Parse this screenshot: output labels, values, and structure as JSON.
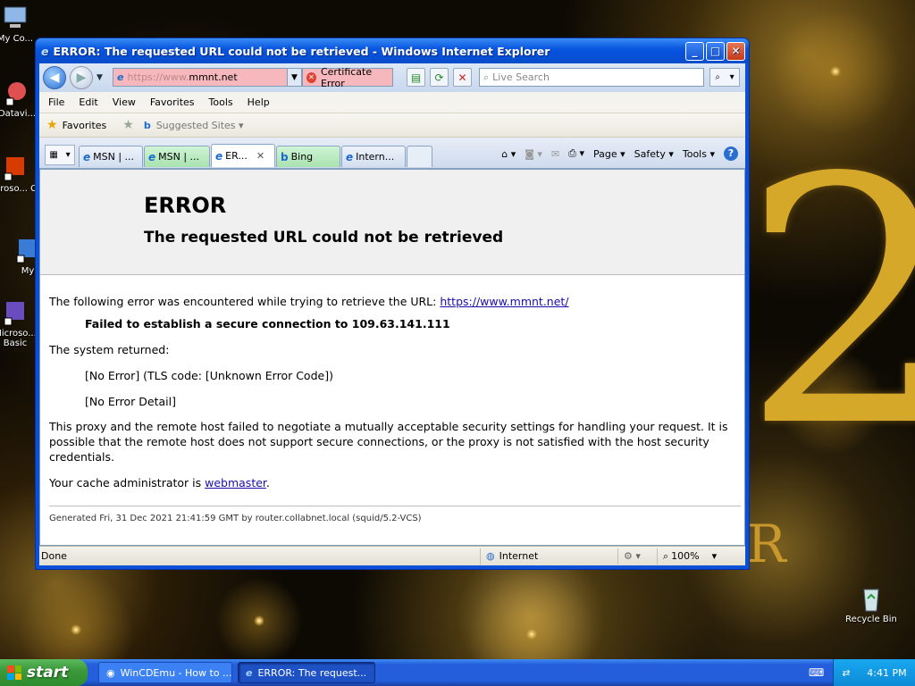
{
  "desktop": {
    "icons": [
      {
        "label": "My Co..."
      },
      {
        "label": "Datavi..."
      },
      {
        "label": "Microso... C..."
      },
      {
        "label": "My"
      },
      {
        "label": "Microso... Basic"
      },
      {
        "label": "Recycle Bin"
      }
    ],
    "wallpaper_numeral": "2",
    "wallpaper_letter": "R"
  },
  "window": {
    "title": "ERROR: The requested URL could not be retrieved - Windows Internet Explorer",
    "buttons": {
      "minimize": "_",
      "maximize": "□",
      "close": "✕"
    }
  },
  "navbar": {
    "back": "◀",
    "forward": "▶",
    "address_dim": "https://www.",
    "address_main": "mmnt.net",
    "cert_label": "Certificate Error",
    "search_placeholder": "Live Search"
  },
  "menubar": {
    "items": [
      "File",
      "Edit",
      "View",
      "Favorites",
      "Tools",
      "Help"
    ]
  },
  "favbar": {
    "favorites": "Favorites",
    "suggested": "Suggested Sites ▾"
  },
  "tabs": [
    {
      "label": "MSN | ...",
      "style": "normal"
    },
    {
      "label": "MSN | ...",
      "style": "green"
    },
    {
      "label": "ER...",
      "style": "selected"
    },
    {
      "label": "Bing",
      "style": "green"
    },
    {
      "label": "Intern...",
      "style": "normal"
    }
  ],
  "commandbar": {
    "page": "Page ▾",
    "safety": "Safety ▾",
    "tools": "Tools ▾",
    "help": "?"
  },
  "page": {
    "heading1": "ERROR",
    "heading2": "The requested URL could not be retrieved",
    "intro": "The following error was encountered while trying to retrieve the URL: ",
    "url_link": "https://www.mmnt.net/",
    "failed": "Failed to establish a secure connection to 109.63.141.111",
    "system_returned": "The system returned:",
    "code_line": "[No Error] (TLS code: [Unknown Error Code])",
    "detail_line": "[No Error Detail]",
    "explanation": "This proxy and the remote host failed to negotiate a mutually acceptable security settings for handling your request. It is possible that the remote host does not support secure connections, or the proxy is not satisfied with the host security credentials.",
    "cache_admin": "Your cache administrator is ",
    "webmaster_link": "webmaster",
    "period": ".",
    "footer": "Generated Fri, 31 Dec 2021 21:41:59 GMT by router.collabnet.local (squid/5.2-VCS)"
  },
  "statusbar": {
    "text": "Done",
    "zone": "Internet",
    "zoom": "100%"
  },
  "taskbar": {
    "start": "start",
    "tasks": [
      {
        "label": "WinCDEmu - How to ...",
        "active": false
      },
      {
        "label": "ERROR: The request...",
        "active": true
      }
    ],
    "clock": "4:41 PM"
  }
}
